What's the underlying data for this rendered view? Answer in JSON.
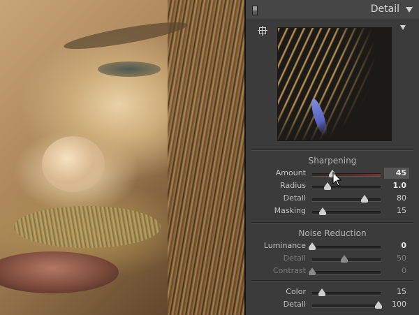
{
  "panel": {
    "title": "Detail"
  },
  "sharpening": {
    "title": "Sharpening",
    "sliders": [
      {
        "label": "Amount",
        "value": "45",
        "fraction": 0.3,
        "bold": true,
        "highlighted": true
      },
      {
        "label": "Radius",
        "value": "1.0",
        "fraction": 0.22,
        "bold": true
      },
      {
        "label": "Detail",
        "value": "80",
        "fraction": 0.77
      },
      {
        "label": "Masking",
        "value": "15",
        "fraction": 0.15
      }
    ]
  },
  "noise_reduction": {
    "title": "Noise Reduction",
    "sliders": [
      {
        "label": "Luminance",
        "value": "0",
        "fraction": 0.0,
        "bold": true
      },
      {
        "label": "Detail",
        "value": "50",
        "fraction": 0.47,
        "dim": true
      },
      {
        "label": "Contrast",
        "value": "0",
        "fraction": 0.0,
        "dim": true
      },
      {
        "label": "Color",
        "value": "15",
        "fraction": 0.14
      },
      {
        "label": "Detail",
        "value": "100",
        "fraction": 0.97
      }
    ]
  },
  "icons": {
    "collapse_toggle": "panel-toggle-icon",
    "panel_menu": "disclosure-triangle-icon",
    "target": "target-adjust-icon",
    "preview_menu": "preview-menu-triangle-icon",
    "cursor": "arrow-cursor-icon"
  },
  "colors": {
    "panel_bg": "#3b3b3b",
    "header_bg": "#464646",
    "amount_track_end": "#8a2f2f"
  }
}
